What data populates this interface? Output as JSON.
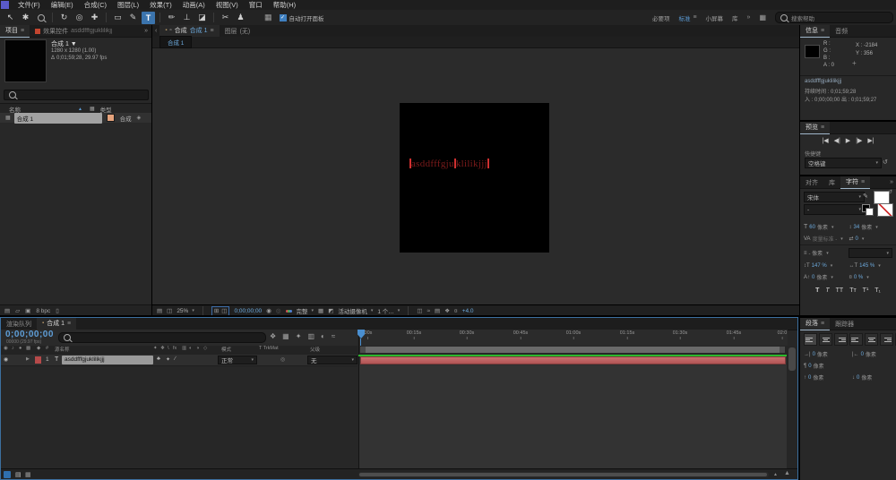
{
  "glyphs": {
    "hamburger": "≡",
    "overflow": "»",
    "chevron_left": "‹",
    "dropdown": "▾",
    "sort_up": "▲",
    "expand_arrow": "▶",
    "check": "✓",
    "panel_box": "▦",
    "tool_selection": "↖",
    "tool_hand": "✱",
    "tool_rotate": "↻",
    "tool_orbit": "◎",
    "tool_pan": "✚",
    "tool_rect": "▭",
    "tool_pen": "✎",
    "tool_text": "T",
    "tool_brush": "✏",
    "tool_stamp": "⊥",
    "tool_eraser": "◪",
    "tool_roto": "✂",
    "tool_puppet": "♟",
    "delta": "Δ",
    "swatch": "▦",
    "comp_item": "▦",
    "flow": "◈",
    "interpret": "▤",
    "folder": "▱",
    "new_comp": "▣",
    "trash": "▯",
    "lock": "▫",
    "panel_icon": "▪",
    "layers": "▤",
    "monitor": "◫",
    "grid_a": "⊞",
    "grid_b": "◫",
    "camera": "◉",
    "ghost": "◎",
    "roi": "▦",
    "tgrid": "◩",
    "pixel_aspect": "◫",
    "fast_preview": "≈",
    "mini_timeline": "▤",
    "mini_flowchart": "❖",
    "exposure": "¤",
    "transport_first": "|◀",
    "transport_prev": "◀|",
    "transport_play": "▶",
    "transport_next": "|▶",
    "transport_last": "▶|",
    "reset": "↺",
    "crosshair": "+",
    "char_size": "T",
    "char_leading": "↕",
    "char_kern": "VA",
    "char_track": "⇄",
    "char_vscale": "↕T",
    "char_hscale": "↔T",
    "char_bshift": "A↑",
    "char_prop": "¤",
    "tl_flowchart": "❖",
    "tl_draft3d": "▦",
    "tl_shy": "✦",
    "tl_blend": "▥",
    "tl_mblur": "◐",
    "tl_graph": "≈",
    "av_eye": "◉",
    "av_audio": "♪",
    "av_solo": "●",
    "av_lock": "▩",
    "col_label": "◆",
    "col_hash": "#",
    "sw": [
      "♣",
      "✦",
      "∕"
    ],
    "switch_header": [
      "✦",
      "❖",
      "\\",
      "fx",
      "▥",
      "◐",
      "◑",
      "◇"
    ],
    "trkmat_none": "◎",
    "mountain": "▲"
  },
  "menubar": {
    "items": [
      "文件(F)",
      "编辑(E)",
      "合成(C)",
      "图层(L)",
      "效果(T)",
      "动画(A)",
      "视图(V)",
      "窗口",
      "帮助(H)"
    ]
  },
  "toolbar": {
    "auto_open": "自动打开面板",
    "workspaces": [
      "必要项",
      "标准",
      "小屏幕",
      "库"
    ],
    "search_placeholder": "搜索帮助"
  },
  "project": {
    "tab_project": "项目",
    "tab_effects": "效果控件",
    "effects_target": "asddfffgjuklilikjjj",
    "comp_name": "合成 1 ▼",
    "comp_dims": "1280 x 1280 (1.00)",
    "comp_time": "0;01;59;28, 29.97 fps",
    "col_name": "名称",
    "col_type": "类型",
    "row_name": "合成 1",
    "row_type": "合成",
    "bpc": "8 bpc"
  },
  "comp": {
    "tab_prefix": "合成",
    "tab_name": "合成 1",
    "tab_layer": "图层",
    "tab_layer_none": "(无)",
    "subtab": "合成 1",
    "text_before": "asddfffgju",
    "text_after": "klilikjjj",
    "zoom": "25%",
    "timecode": "0;00;00;00",
    "resolution": "完整",
    "camera": "活动摄像机",
    "views": "1 个…",
    "exposure": "+4.0"
  },
  "info": {
    "tab_info": "信息",
    "tab_audio": "音频",
    "r": "R :",
    "g": "G :",
    "b": "B :",
    "a": "A : 0",
    "x": "X : -2184",
    "y": "Y : 356",
    "layer_name": "asddfffgjuklilikjjj",
    "duration": "持续时间 : 0;01;59;28",
    "inout": "入 : 0;00;00;00   出 : 0;01;59;27"
  },
  "preview": {
    "title": "预览",
    "shortcut_label": "快捷键",
    "shortcut_value": "空格键"
  },
  "character": {
    "tab_align": "对齐",
    "tab_library": "库",
    "tab_character": "字符",
    "font_family": "宋体",
    "font_style": "-",
    "size_value": "60",
    "size_unit": "像素",
    "leading_value": "34",
    "leading_unit": "像素",
    "kerning_value": "度量标准 -",
    "tracking_value": "0",
    "baseline_option": "- 像素",
    "vscale_value": "147 %",
    "hscale_value": "145 %",
    "bshift_value": "0",
    "bshift_unit": "像素",
    "prop_value": "0 %",
    "faux": [
      "T",
      "T",
      "TT",
      "Tт",
      "T¹",
      "T₁"
    ]
  },
  "paragraph": {
    "tab_paragraph": "段落",
    "tab_tracker": "跟踪器",
    "fields": [
      {
        "icon": "→|",
        "value": "0",
        "unit": "像素"
      },
      {
        "icon": "|←",
        "value": "0",
        "unit": "像素"
      },
      {
        "icon": "¶",
        "value": "0",
        "unit": "像素"
      },
      {
        "icon": "↑",
        "value": "0",
        "unit": "像素"
      },
      {
        "icon": "↓",
        "value": "0",
        "unit": "像素"
      }
    ]
  },
  "timeline": {
    "tab_queue": "渲染队列",
    "tab_comp": "合成 1",
    "timecode": "0;00;00;00",
    "timecode_sub": "00000 (29.97 fps)",
    "col_source": "源名称",
    "col_mode": "模式",
    "col_trkmat": "T TrkMat",
    "col_parent": "父级",
    "row_index": "1",
    "row_type": "T",
    "row_name": "asddfffgjuklilikjjj",
    "row_mode": "正常",
    "row_parent": "无",
    "ticks": [
      ":00s",
      "00:15s",
      "00:30s",
      "00:45s",
      "01:00s",
      "01:15s",
      "01:30s",
      "01:45s",
      "02:0"
    ]
  },
  "colors": {
    "accent_blue": "#5b9bd5",
    "value_blue": "#6ca9dc",
    "layer_red": "#bd5e5e",
    "cache_green": "#2cb82c",
    "comp_text_red": "#7d1b1b",
    "cursor_red": "#d03030",
    "label_peach": "#e4a27c",
    "label_red": "#b64a4a"
  }
}
